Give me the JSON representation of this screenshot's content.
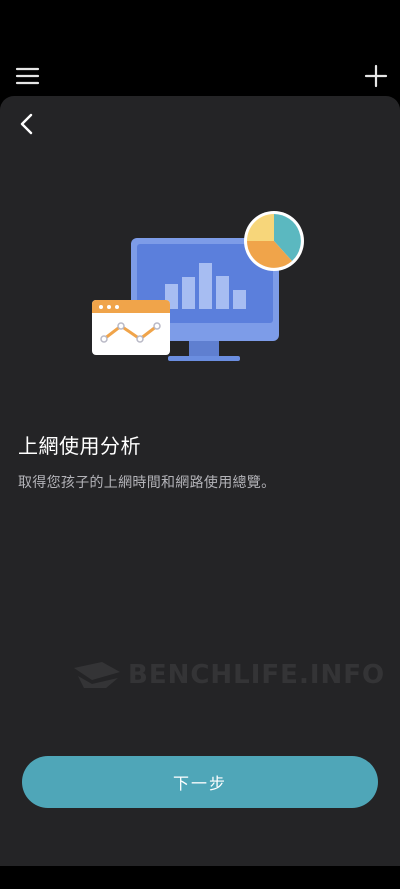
{
  "header": {
    "menu_icon": "hamburger-menu-icon",
    "add_icon": "plus-icon"
  },
  "sheet": {
    "back_icon": "chevron-left-icon",
    "title": "上網使用分析",
    "subtitle": "取得您孩子的上網時間和網路使用總覽。",
    "watermark": "BENCHLIFE.INFO",
    "next_button_label": "下一步"
  },
  "colors": {
    "background": "#000000",
    "sheet": "#242426",
    "accent": "#4fa6b8",
    "monitor": "#6b8ee0",
    "pie_teal": "#5bb8c0",
    "pie_orange": "#f0a44a",
    "pie_yellow": "#f7d67a"
  }
}
